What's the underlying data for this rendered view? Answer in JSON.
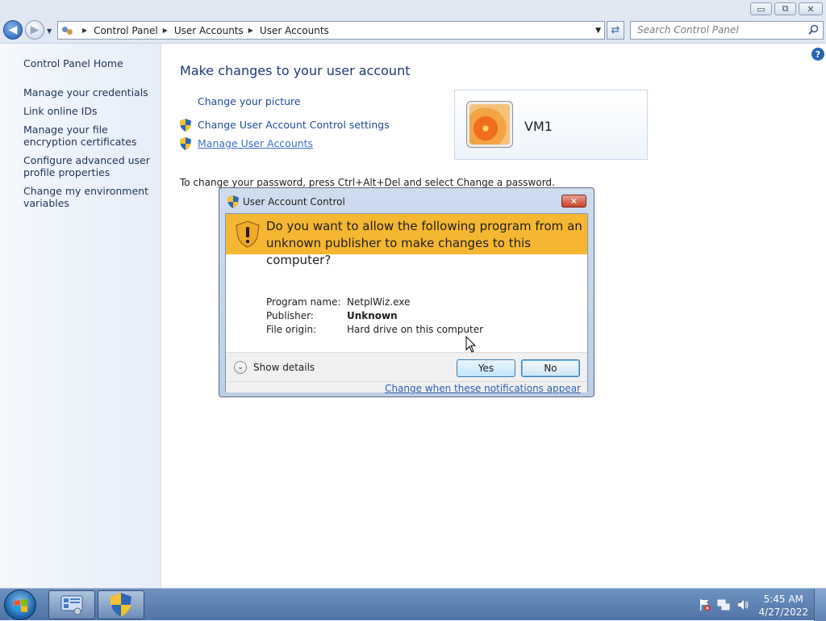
{
  "window": {
    "minimize": "▭",
    "restore": "⧉",
    "close": "✕"
  },
  "address": {
    "crumbs": [
      "Control Panel",
      "User Accounts",
      "User Accounts"
    ],
    "search_placeholder": "Search Control Panel"
  },
  "sidebar": {
    "home": "Control Panel Home",
    "items": [
      {
        "label": "Manage your credentials"
      },
      {
        "label": "Link online IDs"
      },
      {
        "label": "Manage your file encryption certificates"
      },
      {
        "label": "Configure advanced user profile properties"
      },
      {
        "label": "Change my environment variables"
      }
    ]
  },
  "main": {
    "title": "Make changes to your user account",
    "tasks": [
      "Change your picture",
      "Change User Account Control settings",
      "Manage User Accounts"
    ],
    "user_name": "VM1",
    "password_note": "To change your password, press Ctrl+Alt+Del and select Change a password."
  },
  "uac": {
    "title": "User Account Control",
    "question": "Do you want to allow the following program from an unknown publisher to make changes to this computer?",
    "details": [
      {
        "key": "Program name:",
        "value": "NetplWiz.exe"
      },
      {
        "key": "Publisher:",
        "value": "Unknown"
      },
      {
        "key": "File origin:",
        "value": "Hard drive on this computer"
      }
    ],
    "show_details": "Show details",
    "yes": "Yes",
    "no": "No",
    "change_link": "Change when these notifications appear",
    "banner_color": "#f5b731"
  },
  "taskbar": {
    "time": "5:45 AM",
    "date": "4/27/2022"
  }
}
